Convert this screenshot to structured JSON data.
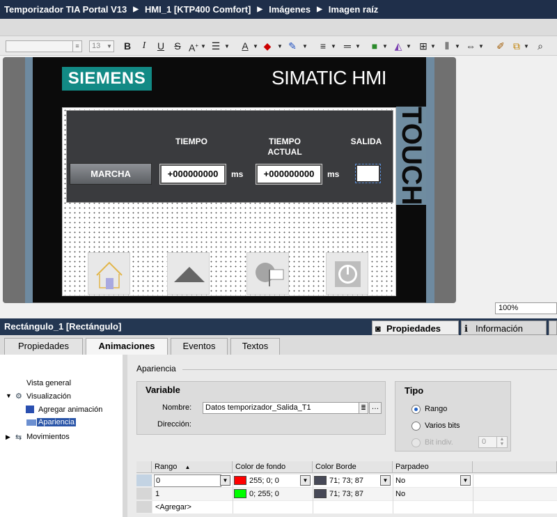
{
  "breadcrumb": [
    "Temporizador TIA Portal V13",
    "HMI_1 [KTP400 Comfort]",
    "Imágenes",
    "Imagen raíz"
  ],
  "toolbar": {
    "font_size": "13",
    "icons": [
      "bold-icon",
      "italic-icon",
      "underline-icon",
      "strikethrough-icon",
      "font-grow-icon",
      "align-icon",
      "font-color-icon",
      "fill-color-icon",
      "line-color-icon",
      "line-width-icon",
      "line-style-icon",
      "arrange-icon",
      "flip-icon",
      "align-objects-icon",
      "distribute-icon",
      "space-icon",
      "brush-icon",
      "layers-icon",
      "zoom-icon"
    ]
  },
  "hmi": {
    "brand": "SIEMENS",
    "product": "SIMATIC HMI",
    "touch": "TOUCH",
    "headers": {
      "tiempo": "TIEMPO",
      "tiempo_actual": "TIEMPO ACTUAL",
      "salida": "SALIDA"
    },
    "button_marcha": "MARCHA",
    "field_tiempo": "+000000000",
    "field_actual": "+000000000",
    "unit": "ms",
    "nav_buttons": [
      "home-icon",
      "up-arrow-icon",
      "language-icon",
      "power-icon"
    ]
  },
  "zoom": "100%",
  "properties": {
    "title": "Rectángulo_1 [Rectángulo]",
    "panel_tabs": [
      "Propiedades",
      "Información"
    ],
    "tabs": [
      "Propiedades",
      "Animaciones",
      "Eventos",
      "Textos"
    ],
    "active_tab": "Animaciones",
    "tree": {
      "vista_general": "Vista general",
      "visualizacion": "Visualización",
      "agregar": "Agregar animación",
      "apariencia": "Apariencia",
      "movimientos": "Movimientos"
    },
    "section_title": "Apariencia",
    "variable": {
      "title": "Variable",
      "nombre_label": "Nombre:",
      "nombre_value": "Datos temporizador_Salida_T1",
      "direccion_label": "Dirección:"
    },
    "tipo": {
      "title": "Tipo",
      "rango": "Rango",
      "varios_bits": "Varios bits",
      "bit_indiv": "Bit indiv.",
      "bit_value": "0",
      "selected": "Rango"
    },
    "table": {
      "headers": [
        "Rango",
        "Color de fondo",
        "Color Borde",
        "Parpadeo"
      ],
      "rows": [
        {
          "rango": "0",
          "fondo": "255; 0; 0",
          "fondo_color": "#ff0000",
          "borde": "71; 73; 87",
          "borde_color": "#474957",
          "parpadeo": "No"
        },
        {
          "rango": "1",
          "fondo": "0; 255; 0",
          "fondo_color": "#00ff00",
          "borde": "71; 73; 87",
          "borde_color": "#474957",
          "parpadeo": "No"
        }
      ],
      "add_label": "<Agregar>"
    }
  }
}
